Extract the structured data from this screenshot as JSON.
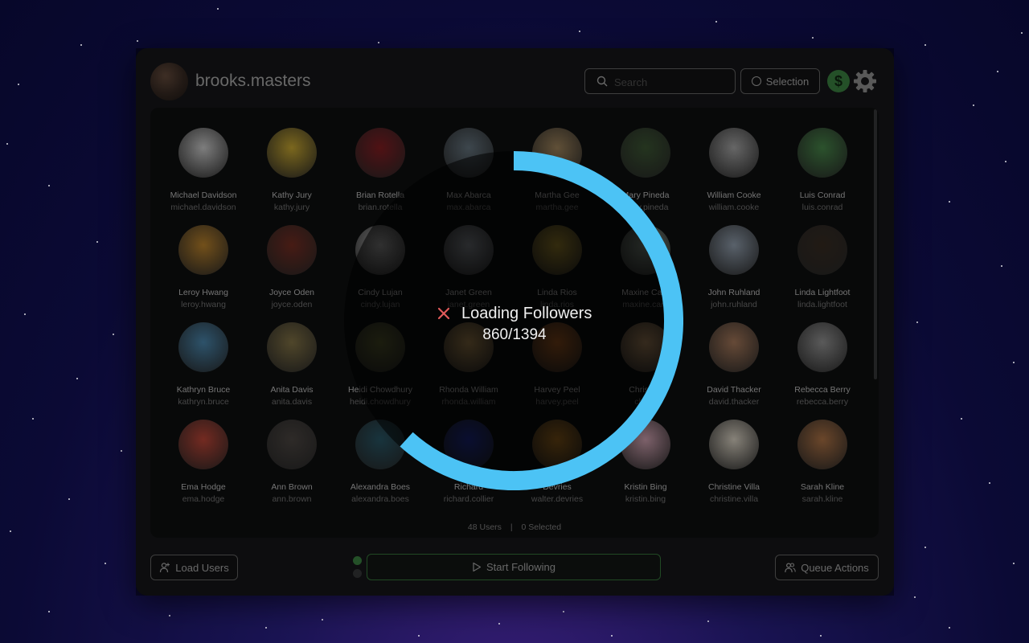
{
  "header": {
    "username": "brooks.masters",
    "search_placeholder": "Search",
    "selection_label": "Selection",
    "dollar_symbol": "$"
  },
  "users": [
    {
      "name": "Michael Davidson",
      "handle": "michael.davidson"
    },
    {
      "name": "Kathy Jury",
      "handle": "kathy.jury"
    },
    {
      "name": "Brian Rotella",
      "handle": "brian.rotella"
    },
    {
      "name": "Max Abarca",
      "handle": "max.abarca"
    },
    {
      "name": "Martha Gee",
      "handle": "martha.gee"
    },
    {
      "name": "Mary Pineda",
      "handle": "mary.pineda"
    },
    {
      "name": "William Cooke",
      "handle": "william.cooke"
    },
    {
      "name": "Luis Conrad",
      "handle": "luis.conrad"
    },
    {
      "name": "Leroy Hwang",
      "handle": "leroy.hwang"
    },
    {
      "name": "Joyce Oden",
      "handle": "joyce.oden"
    },
    {
      "name": "Cindy Lujan",
      "handle": "cindy.lujan"
    },
    {
      "name": "Janet Green",
      "handle": "janet.green"
    },
    {
      "name": "Linda Rios",
      "handle": "linda.rios"
    },
    {
      "name": "Maxine Carp",
      "handle": "maxine.carp"
    },
    {
      "name": "John Ruhland",
      "handle": "john.ruhland"
    },
    {
      "name": "Linda Lightfoot",
      "handle": "linda.lightfoot"
    },
    {
      "name": "Kathryn Bruce",
      "handle": "kathryn.bruce"
    },
    {
      "name": "Anita Davis",
      "handle": "anita.davis"
    },
    {
      "name": "Heidi Chowdhury",
      "handle": "heidi.chowdhury"
    },
    {
      "name": "Rhonda William",
      "handle": "rhonda.william"
    },
    {
      "name": "Harvey Peel",
      "handle": "harvey.peel"
    },
    {
      "name": "Christine",
      "handle": "christi"
    },
    {
      "name": "David Thacker",
      "handle": "david.thacker"
    },
    {
      "name": "Rebecca Berry",
      "handle": "rebecca.berry"
    },
    {
      "name": "Ema Hodge",
      "handle": "ema.hodge"
    },
    {
      "name": "Ann Brown",
      "handle": "ann.brown"
    },
    {
      "name": "Alexandra Boes",
      "handle": "alexandra.boes"
    },
    {
      "name": "Richard",
      "handle": "richard.collier"
    },
    {
      "name": "Devries",
      "handle": "walter.devries"
    },
    {
      "name": "Kristin Bing",
      "handle": "kristin.bing"
    },
    {
      "name": "Christine Villa",
      "handle": "christine.villa"
    },
    {
      "name": "Sarah Kline",
      "handle": "sarah.kline"
    }
  ],
  "avatar_colors": [
    "#d8d8d8",
    "#d4b234",
    "#8a1f24",
    "#6a7a85",
    "#a68a60",
    "#3f5a36",
    "#b0b0b0",
    "#4c8e4e",
    "#c58a2e",
    "#7a3024",
    "#b8b8b8",
    "#9aa0a8",
    "#c0a236",
    "#8a9a8c",
    "#9aa8b8",
    "#3a2e24",
    "#4f8fb8",
    "#8a7a4a",
    "#6a6e3a",
    "#c8a060",
    "#c06a2a",
    "#caa070",
    "#b08060",
    "#9c9c9c",
    "#c84a3a",
    "#504a46",
    "#2a5a6a",
    "#2a3ab8",
    "#d08a2a",
    "#d8a8b8",
    "#e8e0d0",
    "#b87a4a"
  ],
  "status": {
    "users_count": "48 Users",
    "selected_count": "0 Selected"
  },
  "footer": {
    "load_users_label": "Load Users",
    "start_following_label": "Start Following",
    "queue_actions_label": "Queue Actions"
  },
  "loading": {
    "title": "Loading Followers",
    "count": "860/1394",
    "progress": 0.617,
    "accent_color": "#4cc3f5"
  },
  "colors": {
    "green_accent": "#3e8a45",
    "cancel_red": "#e05a5a"
  }
}
